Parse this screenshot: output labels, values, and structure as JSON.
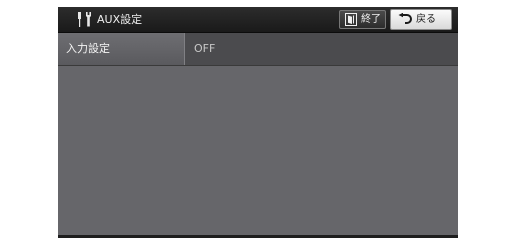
{
  "header": {
    "title": "AUX設定",
    "title_icon": "settings-tools-icon",
    "end_button_label": "終了",
    "end_button_icon": "exit-door-icon",
    "back_button_label": "戻る",
    "back_button_icon": "return-arrow-icon"
  },
  "settings": {
    "rows": [
      {
        "label": "入力設定",
        "value": "OFF"
      }
    ]
  },
  "colors": {
    "header_bg": "#1a1a1a",
    "content_bg": "#66666a",
    "row_bg": "#4b4b4e",
    "back_button_bg": "#e9e9e9"
  }
}
